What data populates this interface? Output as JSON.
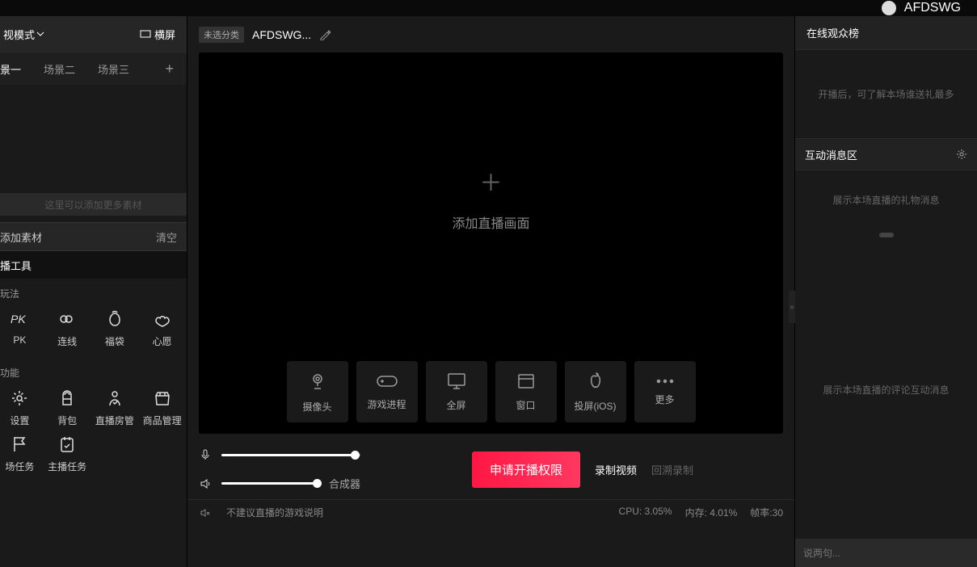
{
  "topbar": {
    "username": "AFDSWG"
  },
  "left": {
    "mode_label": "视模式",
    "screen_label": "横屏",
    "tabs": [
      "景一",
      "场景二",
      "场景三"
    ],
    "scene_hint": "这里可以添加更多素材",
    "add_material": "添加素材",
    "clear": "清空",
    "tools_title": "播工具",
    "play_section": "玩法",
    "play_items": [
      "PK",
      "连线",
      "福袋",
      "心愿"
    ],
    "func_section": "功能",
    "func_items": [
      "设置",
      "背包",
      "直播房管",
      "商品管理",
      "场任务",
      "主播任务"
    ]
  },
  "center": {
    "category_tag": "未选分类",
    "title": "AFDSWG...",
    "add_hint": "添加直播画面",
    "sources": [
      "摄像头",
      "游戏进程",
      "全屏",
      "窗口",
      "投屏(iOS)",
      "更多"
    ],
    "synth_label": "合成器",
    "main_button": "申请开播权限",
    "record": "录制视频",
    "replay": "回溯录制",
    "warning": "不建议直播的游戏说明",
    "cpu_label": "CPU:",
    "cpu_val": "3.05%",
    "mem_label": "内存:",
    "mem_val": "4.01%",
    "fps_label": "帧率:",
    "fps_val": "30"
  },
  "right": {
    "rank_title": "在线观众榜",
    "rank_hint": "开播后，可了解本场谁送礼最多",
    "msg_title": "互动消息区",
    "gift_hint": "展示本场直播的礼物消息",
    "comment_hint": "展示本场直播的评论互动消息",
    "input_placeholder": "说两句..."
  }
}
